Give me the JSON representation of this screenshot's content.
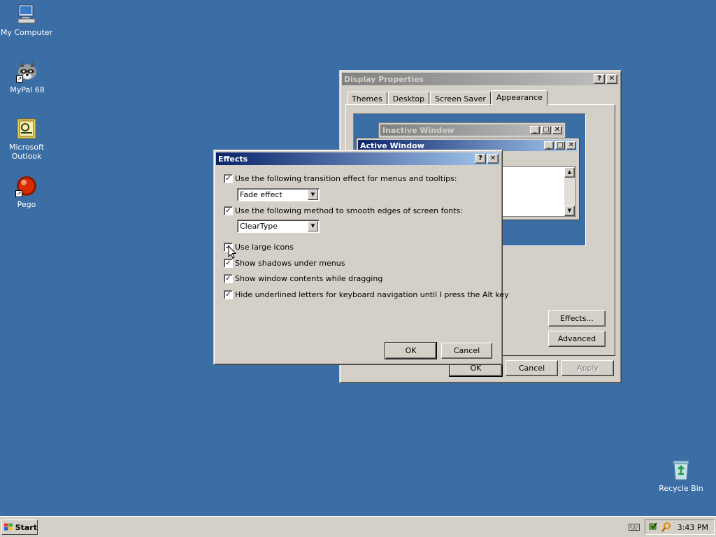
{
  "desktop": {
    "icons": [
      {
        "label": "My Computer",
        "icon": "my-computer-icon"
      },
      {
        "label": "MyPal 68",
        "icon": "raccoon-browser-icon"
      },
      {
        "label": "Microsoft Outlook",
        "icon": "outlook-icon"
      },
      {
        "label": "Pego",
        "icon": "red-ball-icon"
      },
      {
        "label": "Recycle Bin",
        "icon": "recycle-bin-icon"
      }
    ]
  },
  "display_properties": {
    "title": "Display Properties",
    "tabs": [
      "Themes",
      "Desktop",
      "Screen Saver",
      "Appearance"
    ],
    "selected_tab": "Appearance",
    "preview": {
      "inactive_title": "Inactive Window",
      "active_title": "Active Window"
    },
    "effects_button": "Effects...",
    "advanced_button": "Advanced",
    "ok": "OK",
    "cancel": "Cancel",
    "apply": "Apply"
  },
  "effects": {
    "title": "Effects",
    "options": [
      {
        "label": "Use the following transition effect for menus and tooltips:",
        "checked": true
      },
      {
        "label": "Use the following method to smooth edges of screen fonts:",
        "checked": true
      },
      {
        "label": "Use large icons",
        "checked": true
      },
      {
        "label": "Show shadows under menus",
        "checked": true
      },
      {
        "label": "Show window contents while dragging",
        "checked": true
      },
      {
        "label": "Hide underlined letters for keyboard navigation until I press the Alt key",
        "checked": true
      }
    ],
    "transition_value": "Fade effect",
    "smoothing_value": "ClearType",
    "ok": "OK",
    "cancel": "Cancel"
  },
  "taskbar": {
    "start_label": "Start",
    "clock": "3:43 PM"
  },
  "colors": {
    "desktop": "#3a6ea5",
    "active_title_start": "#0a246a",
    "active_title_end": "#a6caf0",
    "face": "#d4d0c8"
  }
}
